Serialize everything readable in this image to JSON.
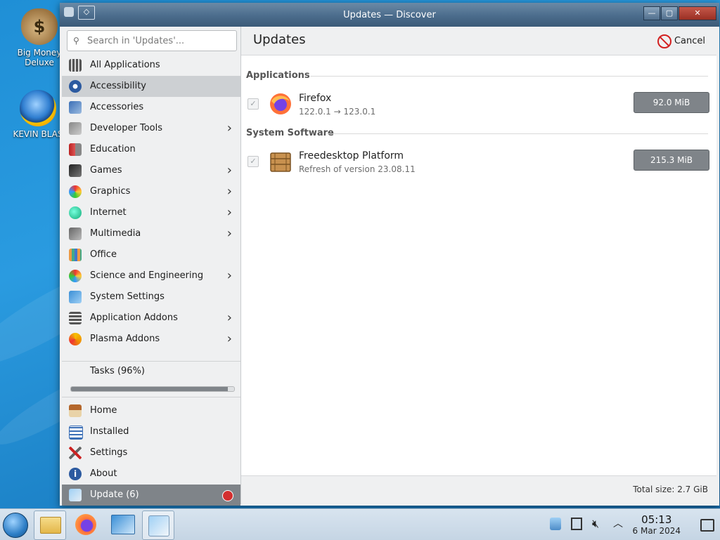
{
  "desktop": {
    "icons": [
      {
        "label": "Big Money Deluxe"
      },
      {
        "label": "KEVIN BLAS"
      }
    ]
  },
  "window": {
    "title": "Updates — Discover"
  },
  "sidebar": {
    "search_placeholder": "Search in 'Updates'...",
    "categories": [
      {
        "label": "All Applications",
        "icon": "grid-icon",
        "has_submenu": false
      },
      {
        "label": "Accessibility",
        "icon": "accessibility-icon",
        "has_submenu": false,
        "selected": true
      },
      {
        "label": "Accessories",
        "icon": "accessories-icon",
        "has_submenu": false
      },
      {
        "label": "Developer Tools",
        "icon": "developer-tools-icon",
        "has_submenu": true
      },
      {
        "label": "Education",
        "icon": "education-icon",
        "has_submenu": false
      },
      {
        "label": "Games",
        "icon": "games-icon",
        "has_submenu": true
      },
      {
        "label": "Graphics",
        "icon": "graphics-icon",
        "has_submenu": true
      },
      {
        "label": "Internet",
        "icon": "internet-icon",
        "has_submenu": true
      },
      {
        "label": "Multimedia",
        "icon": "multimedia-icon",
        "has_submenu": true
      },
      {
        "label": "Office",
        "icon": "office-icon",
        "has_submenu": false
      },
      {
        "label": "Science and Engineering",
        "icon": "science-icon",
        "has_submenu": true
      },
      {
        "label": "System Settings",
        "icon": "system-settings-icon",
        "has_submenu": false
      },
      {
        "label": "Application Addons",
        "icon": "addons-icon",
        "has_submenu": true
      },
      {
        "label": "Plasma Addons",
        "icon": "plasma-icon",
        "has_submenu": true
      }
    ],
    "tasks_label": "Tasks (96%)",
    "tasks_progress": 0.96,
    "nav": [
      {
        "label": "Home",
        "icon": "home-icon"
      },
      {
        "label": "Installed",
        "icon": "installed-list-icon"
      },
      {
        "label": "Settings",
        "icon": "settings-tools-icon"
      },
      {
        "label": "About",
        "icon": "info-icon"
      },
      {
        "label": "Update (6)",
        "icon": "update-icon",
        "active": true
      }
    ]
  },
  "main": {
    "title": "Updates",
    "cancel_label": "Cancel",
    "sections": [
      {
        "heading": "Applications",
        "items": [
          {
            "name": "Firefox",
            "detail": "122.0.1 → 123.0.1",
            "size": "92.0 MiB",
            "icon": "firefox-icon"
          }
        ]
      },
      {
        "heading": "System Software",
        "items": [
          {
            "name": "Freedesktop Platform",
            "detail": "Refresh of version 23.08.11",
            "size": "215.3 MiB",
            "icon": "package-crate-icon"
          }
        ]
      }
    ],
    "total_size": "Total size: 2.7 GiB"
  },
  "taskbar": {
    "time": "05:13",
    "date": "6 Mar 2024"
  },
  "colors": {
    "accent": "#7f8489",
    "selection": "#cdd0d3",
    "titlebar": "#4b6c8c",
    "badge": "#d32f2f"
  }
}
